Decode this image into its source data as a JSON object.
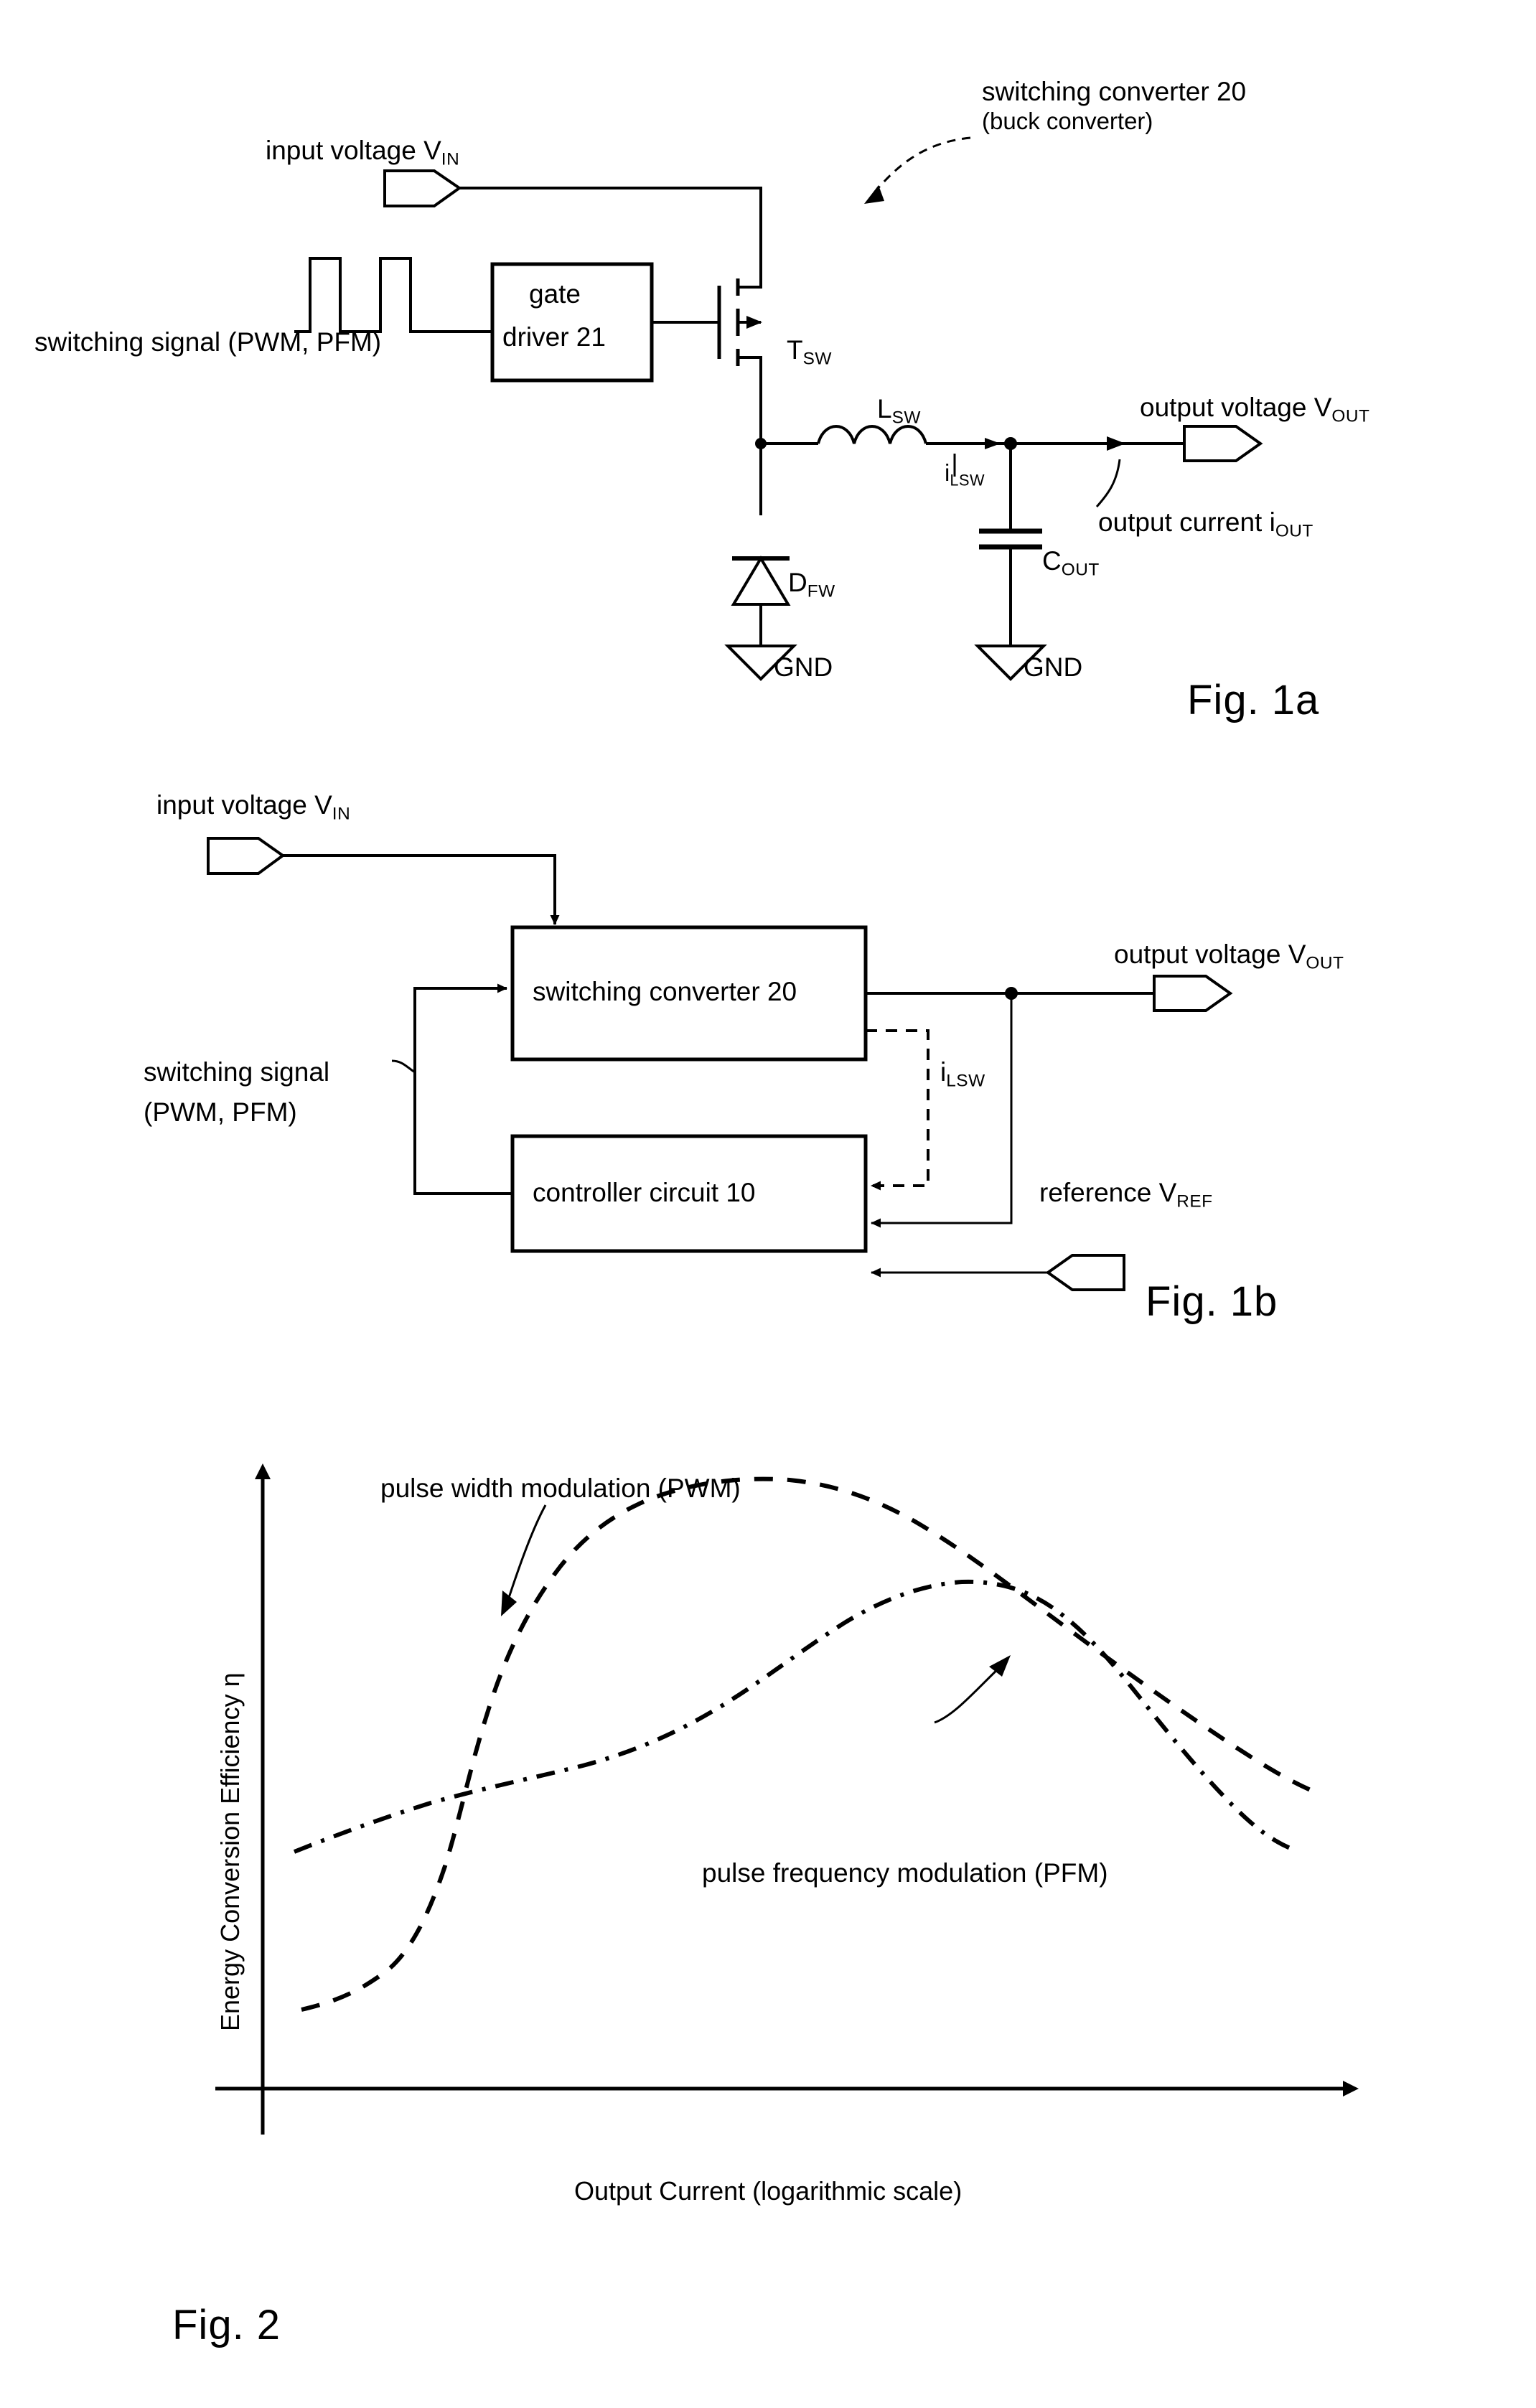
{
  "document": {
    "type": "patent-drawing-sheet",
    "background_color": "#ffffff",
    "ink_color": "#000000"
  },
  "figure_1a": {
    "caption": "Fig. 1a",
    "callout": {
      "line1": "switching converter 20",
      "line2": "(buck converter)"
    },
    "input_terminal": {
      "label_text": "input voltage V",
      "label_sub": "IN",
      "symbol": "port-pentagon-right"
    },
    "switching_signal": {
      "label_text": "switching signal (PWM, PFM)",
      "waveform": "two-pulse-square-wave"
    },
    "gate_driver": {
      "line1": "gate",
      "line2": "driver 21"
    },
    "transistor": {
      "label_text": "T",
      "label_sub": "SW",
      "symbol": "mosfet-p-channel"
    },
    "inductor": {
      "label_text": "L",
      "label_sub": "SW",
      "symbol": "inductor-coil"
    },
    "inductor_current": {
      "label_text": "i",
      "label_sub": "LSW"
    },
    "diode": {
      "label_text": "D",
      "label_sub": "FW",
      "symbol": "diode-freewheeling"
    },
    "capacitor": {
      "label_text": "C",
      "label_sub": "OUT",
      "symbol": "capacitor"
    },
    "ground_left": {
      "label_text": "GND",
      "symbol": "ground-triangle"
    },
    "ground_right": {
      "label_text": "GND",
      "symbol": "ground-triangle"
    },
    "output_terminal": {
      "label_text": "output voltage V",
      "label_sub": "OUT",
      "symbol": "port-pentagon-right"
    },
    "output_current": {
      "label_text": "output current i",
      "label_sub": "OUT"
    }
  },
  "figure_1b": {
    "caption": "Fig. 1b",
    "input_terminal": {
      "label_text": "input voltage V",
      "label_sub": "IN",
      "symbol": "port-pentagon-right"
    },
    "block_converter": {
      "label": "switching converter 20"
    },
    "block_controller": {
      "label": "controller circuit 10"
    },
    "switching_signal": {
      "line1": "switching signal",
      "line2": "(PWM, PFM)"
    },
    "feedback_current": {
      "label_text": "i",
      "label_sub": "LSW"
    },
    "output_terminal": {
      "label_text": "output voltage V",
      "label_sub": "OUT",
      "symbol": "port-pentagon-right"
    },
    "reference_terminal": {
      "label_text": "reference V",
      "label_sub": "REF",
      "symbol": "port-pentagon-left"
    }
  },
  "figure_2": {
    "caption": "Fig. 2",
    "annotation_pwm": "pulse width modulation (PWM)",
    "annotation_pfm": "pulse frequency modulation (PFM)"
  },
  "chart_data": {
    "type": "line",
    "title": "",
    "xlabel": "Output Current (logarithmic scale)",
    "ylabel_text": "Energy Conversion Efficiency ",
    "ylabel_symbol": "η",
    "x_scale": "logarithmic",
    "grid": false,
    "axes": "two-arrow-axes-no-ticks",
    "legend_position": "inline-annotations",
    "xlim": [
      0,
      10
    ],
    "ylim": [
      0,
      10
    ],
    "series": [
      {
        "name": "pulse width modulation (PWM)",
        "line_style": "dashed",
        "x": [
          0.3,
          0.8,
          1.3,
          1.8,
          2.15,
          2.45,
          2.75,
          3.05,
          3.4,
          3.9,
          4.6,
          5.4,
          6.3,
          7.2,
          8.1,
          9.0,
          9.6
        ],
        "y": [
          1.0,
          1.25,
          1.7,
          2.45,
          3.25,
          4.3,
          5.4,
          6.4,
          7.25,
          7.9,
          8.25,
          8.15,
          7.7,
          7.05,
          6.3,
          5.55,
          5.0
        ]
      },
      {
        "name": "pulse frequency modulation (PFM)",
        "line_style": "dash-dot",
        "x": [
          0.3,
          0.95,
          1.6,
          2.25,
          2.9,
          3.55,
          4.2,
          4.85,
          5.5,
          6.15,
          6.7,
          7.25,
          7.9,
          8.55,
          9.2,
          9.7
        ],
        "y": [
          3.1,
          3.5,
          3.85,
          4.1,
          4.25,
          4.45,
          4.8,
          5.25,
          5.7,
          5.95,
          5.9,
          5.6,
          5.1,
          4.55,
          4.0,
          3.7
        ]
      }
    ]
  }
}
